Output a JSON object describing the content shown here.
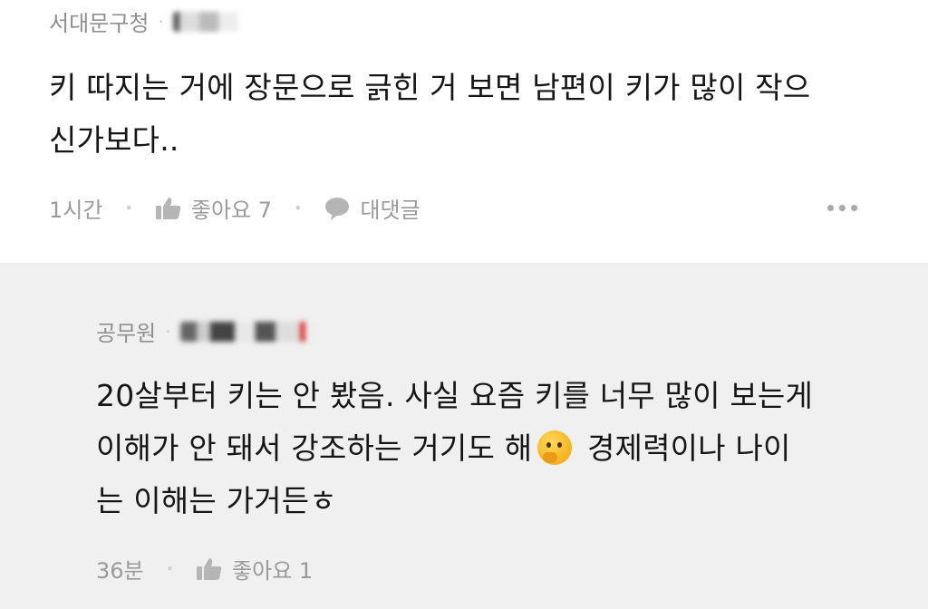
{
  "comments": [
    {
      "author": "서대문구청",
      "separator": "·",
      "body_line1": "키 따지는 거에 장문으로 긁힌 거 보면 남편이 키가 많이 작으",
      "body_line2": "신가보다..",
      "time": "1시간",
      "like_label": "좋아요 7",
      "reply_label": "대댓글"
    },
    {
      "author": "공무원",
      "separator": "·",
      "body_line1": "20살부터 키는 안 봤음. 사실 요즘 키를 너무 많이 보는게",
      "body_line2a": "이해가 안 돼서 강조하는 거기도 해",
      "emoji": "thinking-face-emoji",
      "body_line2b": " 경제력이나 나이",
      "body_line3": "는 이해는 가거든ㅎ",
      "time": "36분",
      "like_label": "좋아요 1"
    }
  ],
  "colors": {
    "reply_background": "#f0f0f1",
    "meta_text": "#8f8f8f",
    "body_text": "#161616"
  }
}
